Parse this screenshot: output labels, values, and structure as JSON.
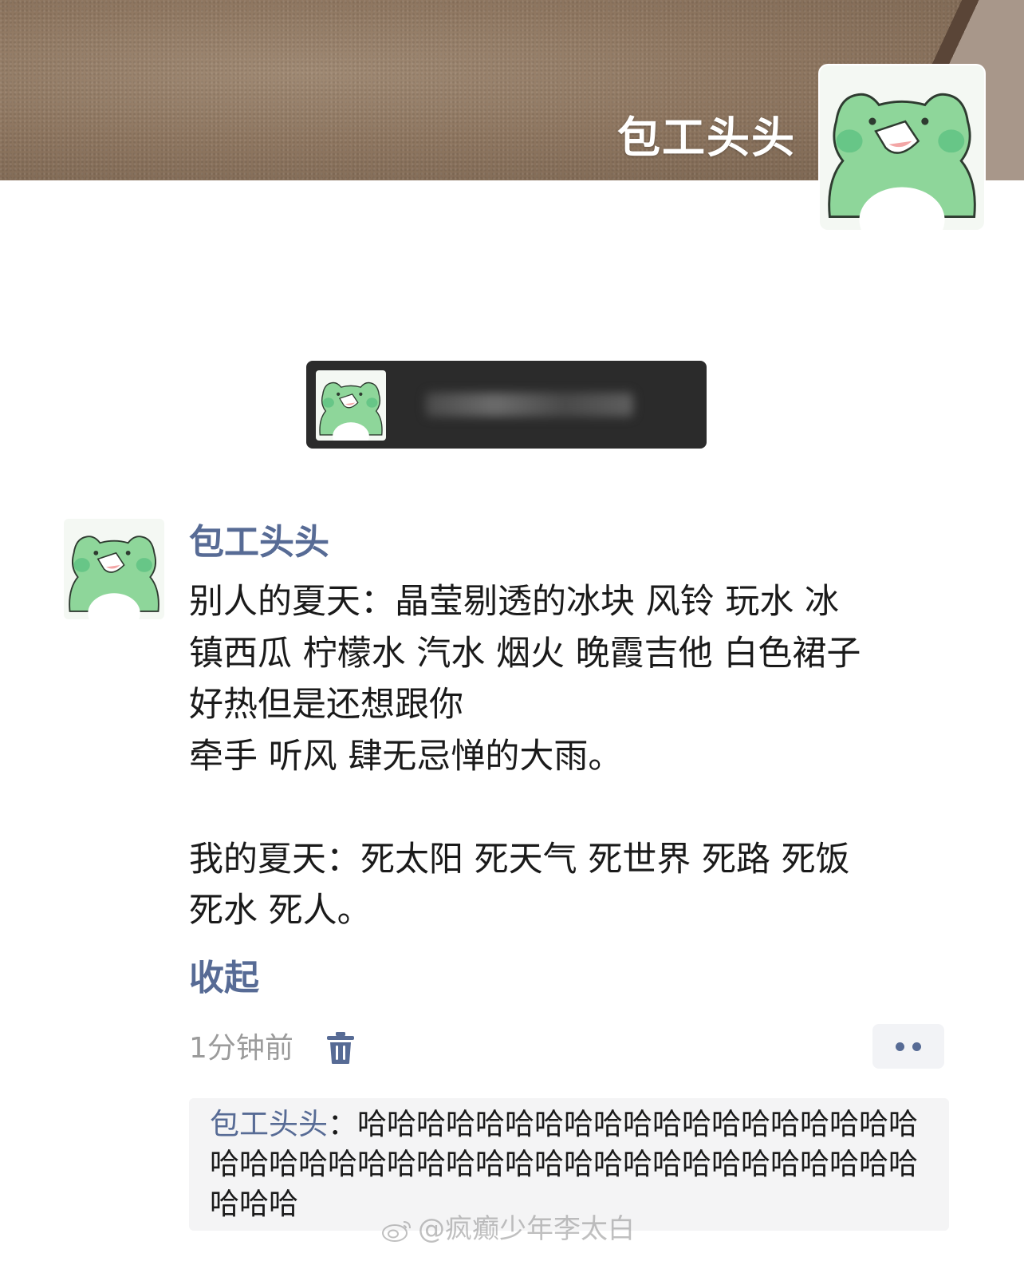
{
  "cover": {
    "display_name": "包工头头"
  },
  "banner": {
    "avatar": "frog-avatar-icon"
  },
  "post": {
    "author": "包工头头",
    "lines": [
      "别人的夏天：晶莹剔透的冰块 风铃 玩水 冰",
      "镇西瓜 柠檬水 汽水 烟火 晚霞吉他 白色裙子",
      "好热但是还想跟你",
      "牵手 听风 肆无忌惮的大雨。",
      "",
      "我的夏天：死太阳 死天气 死世界 死路 死饭",
      "死水 死人。"
    ],
    "collapse_label": "收起",
    "timestamp": "1分钟前"
  },
  "comments": [
    {
      "author": "包工头头",
      "separator": "：",
      "text": "哈哈哈哈哈哈哈哈哈哈哈哈哈哈哈哈哈哈哈哈哈哈哈哈哈哈哈哈哈哈哈哈哈哈哈哈哈哈哈哈哈哈哈哈哈哈"
    }
  ],
  "watermark": "@疯癫少年李太白",
  "colors": {
    "link": "#576b95",
    "text": "#1a1a1a",
    "muted": "#9b9b9b",
    "comment_bg": "#f4f4f5"
  }
}
